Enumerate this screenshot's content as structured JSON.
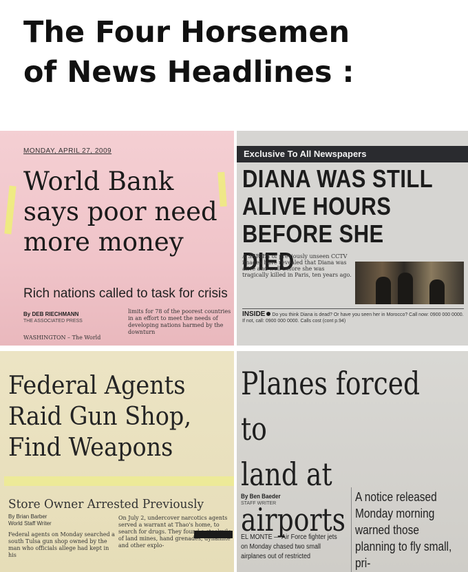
{
  "meme": {
    "title": "The Four Horsemen\nof News Headlines :"
  },
  "panels": [
    {
      "date": "MONDAY, APRIL 27, 2009",
      "headline": "World Bank\nsays poor need\nmore money",
      "deck": "Rich nations called to task for crisis",
      "byline": "By DEB RIECHMANN",
      "agency": "THE ASSOCIATED PRESS",
      "body": "limits for 78 of the poorest countries in an effort to meet the needs of developing nations harmed by the downturn",
      "dateline": "WASHINGTON – The World"
    },
    {
      "banner": "Exclusive To All Newspapers",
      "headline": "DIANA WAS STILL\nALIVE HOURS\nBEFORE SHE DIED",
      "body": "A SERIES of previously unseen CCTV images have revealed that Diana was alive and well before she was tragically killed in Paris, ten years ago.",
      "inside_label": "INSIDE",
      "inside_text": "Do you think Diana is dead? Or have you seen her in Morocco? Call now: 0900 000 0000. If not, call: 0900 000 0000. Calls cost (cont p.94)"
    },
    {
      "headline": "Federal Agents\nRaid Gun Shop,\nFind Weapons",
      "deck": "Store Owner Arrested Previously",
      "byline": "By Brian Barber",
      "staff": "World Staff Writer",
      "body_left": "Federal agents on Monday searched a south Tulsa gun shop owned by the man who officials allege had kept in his",
      "body_right": "On July 2, undercover narcotics agents served a warrant at Thao's home, to search for drugs. They found a stockpile of land mines, hand grenades, dynamite and other explo-"
    },
    {
      "headline": "Planes forced to\nland at airports",
      "byline": "By Ben Baeder",
      "staff": "STAFF WRITER",
      "body_left": "EL MONTE — Air Force fighter jets on Monday chased two small airplanes out of restricted",
      "body_right": "A notice released Monday morning warned those planning to fly small, pri-"
    }
  ],
  "colors": {
    "panel1_bg": "#f0c4c9",
    "panel2_bg": "#d6d5d2",
    "panel2_banner": "#2a2b2f",
    "panel3_bg": "#e6ddb8",
    "panel4_bg": "#cfcdc8",
    "highlighter": "#eef56a"
  }
}
